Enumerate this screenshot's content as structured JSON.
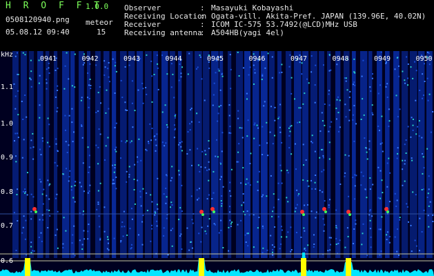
{
  "app": {
    "name": "H R O F F T",
    "version": "1.0.0"
  },
  "file": {
    "name": "0508120940.png",
    "datetime": "05.08.12 09:40"
  },
  "meteor": {
    "label": "meteor",
    "count": "15"
  },
  "info": [
    {
      "label": "Observer",
      "value": "Masayuki Kobayashi"
    },
    {
      "label": "Receiving Location",
      "value": "Ogata-vill. Akita-Pref. JAPAN (139.96E, 40.02N)"
    },
    {
      "label": "Receiver",
      "value": "ICOM IC-575 53.7492(@LCD)MHz USB"
    },
    {
      "label": "Receiving antenna",
      "value": "A504HB(yagi 4el)"
    }
  ],
  "separator": ":",
  "yaxis": {
    "unit": "kHz",
    "ticks": [
      "1.1",
      "1.0",
      "0.9",
      "0.8",
      "0.7",
      "0.6"
    ]
  },
  "xaxis": {
    "ticks": [
      "0941",
      "0942",
      "0943",
      "0944",
      "0945",
      "0946",
      "0947",
      "0948",
      "0949",
      "0950"
    ]
  },
  "colors": {
    "background": "#000000",
    "accent": "#7cff5a",
    "spectrum_base": "#00106a",
    "peak": "#ffff00",
    "baseline": "#00e5ff"
  }
}
